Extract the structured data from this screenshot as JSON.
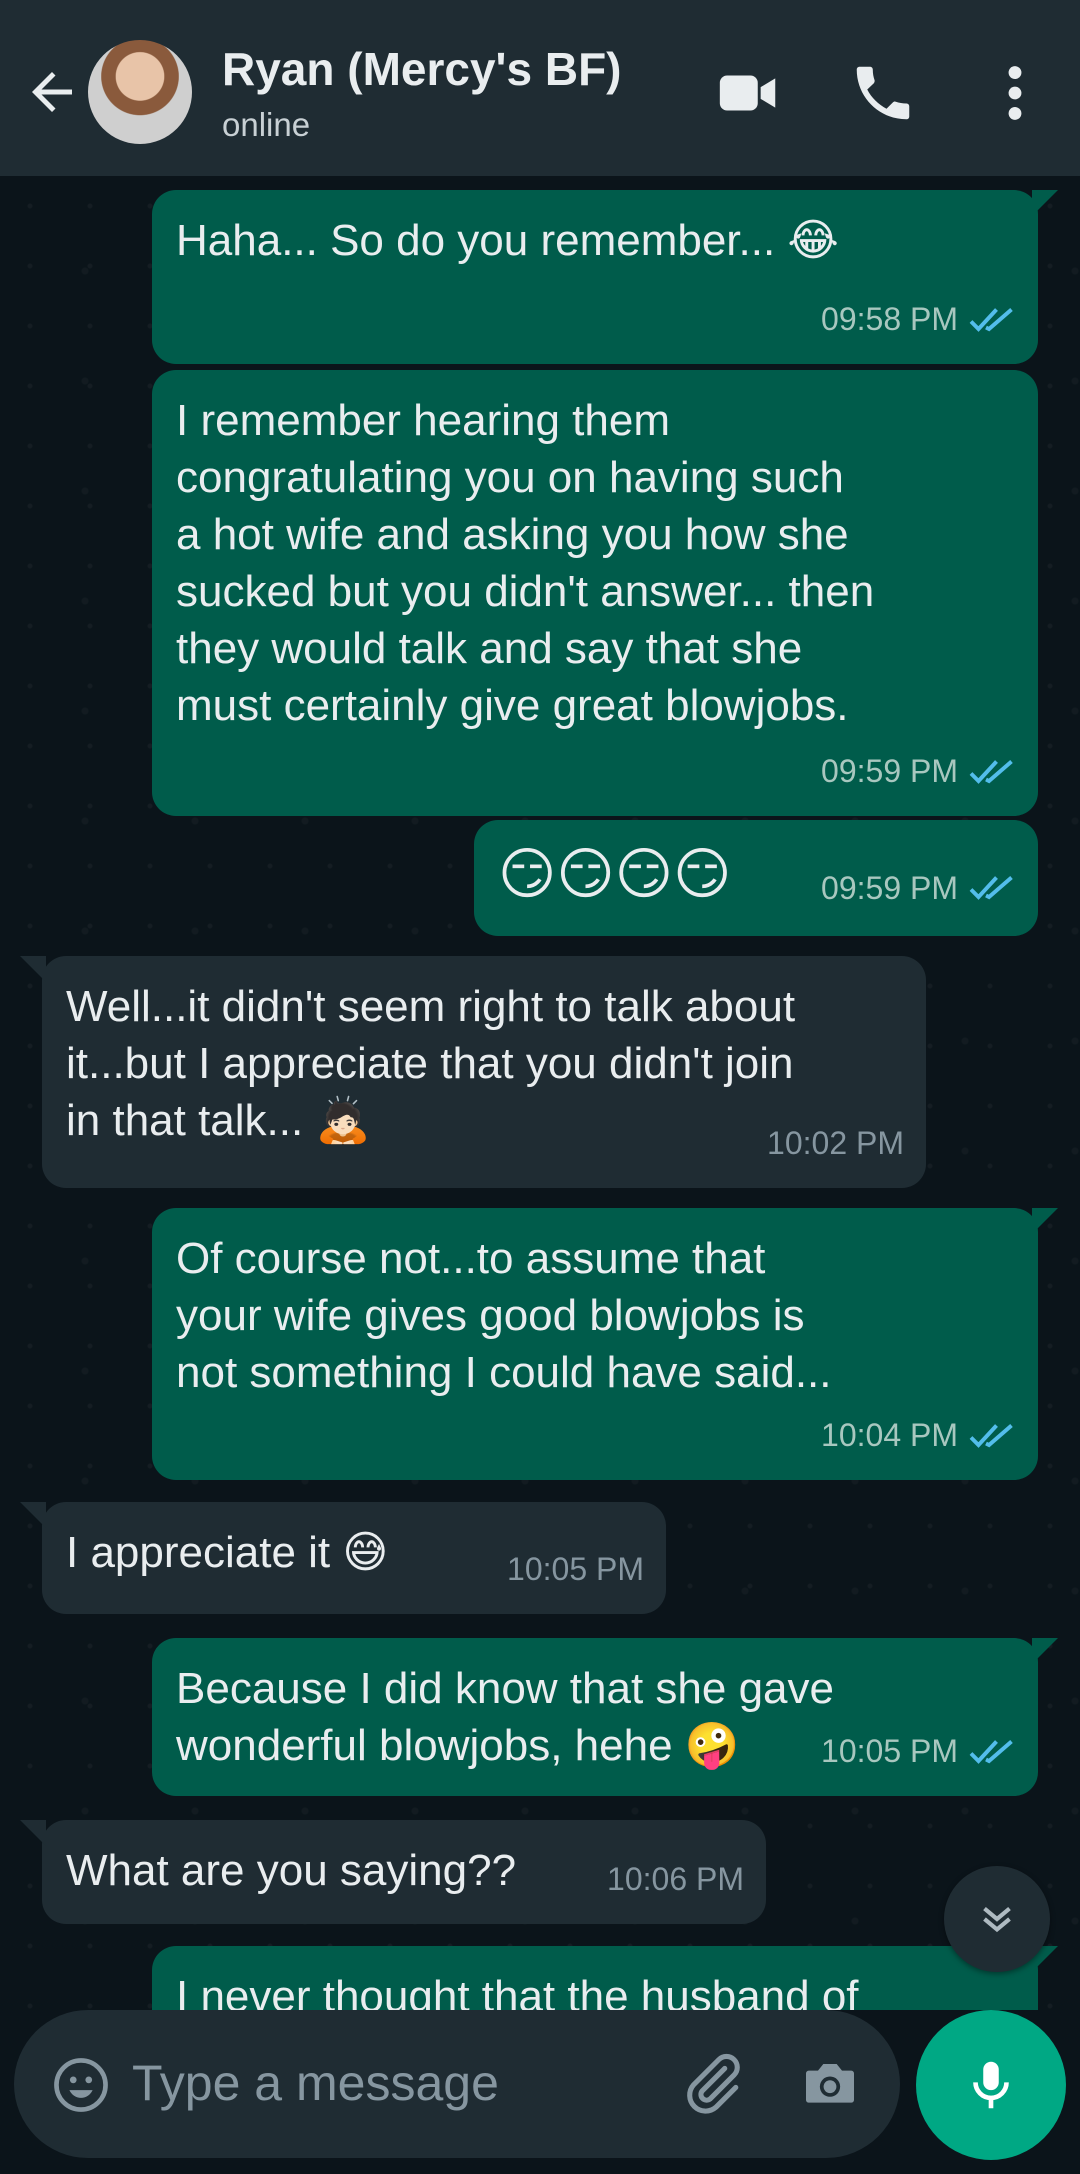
{
  "header": {
    "contact_name": "Ryan (Mercy's BF)",
    "status": "online"
  },
  "messages": [
    {
      "dir": "out",
      "text": "Haha... So do you remember... 😂",
      "time": "09:58 PM",
      "read": true
    },
    {
      "dir": "out",
      "text": "I remember hearing them\ncongratulating you on having such\na hot wife and asking you how she\nsucked but you didn't answer... then\nthey would talk and say that she\nmust certainly give great blowjobs.",
      "time": "09:59 PM",
      "read": true
    },
    {
      "dir": "out",
      "text": "😏😏😏😏",
      "time": "09:59 PM",
      "read": true
    },
    {
      "dir": "in",
      "text": "Well...it didn't seem right to talk about\nit...but I appreciate that you didn't join\nin that talk... 🙇🏻",
      "time": "10:02 PM"
    },
    {
      "dir": "out",
      "text": "Of course not...to assume that\nyour wife gives good blowjobs is\nnot something I could have said...",
      "time": "10:04 PM",
      "read": true
    },
    {
      "dir": "in",
      "text": "I appreciate it 😅",
      "time": "10:05 PM"
    },
    {
      "dir": "out",
      "text": "Because I did know that she gave\nwonderful blowjobs, hehe 🤪",
      "time": "10:05 PM",
      "read": true
    },
    {
      "dir": "in",
      "text": "What are you saying??",
      "time": "10:06 PM"
    },
    {
      "dir": "out",
      "text": "I never thought that the husband of",
      "time": "",
      "read": false
    }
  ],
  "composer": {
    "placeholder": "Type a message"
  },
  "colors": {
    "header_bg": "#1f2c33",
    "chat_bg": "#0b141a",
    "outgoing_bubble": "#005c4b",
    "incoming_bubble": "#1f2c33",
    "read_ticks": "#53bdeb",
    "mic_button": "#00a884"
  },
  "icons": [
    "back-arrow-icon",
    "video-call-icon",
    "phone-icon",
    "more-vert-icon",
    "double-check-icon",
    "chevron-down-icon",
    "emoji-icon",
    "attach-icon",
    "camera-icon",
    "mic-icon"
  ]
}
